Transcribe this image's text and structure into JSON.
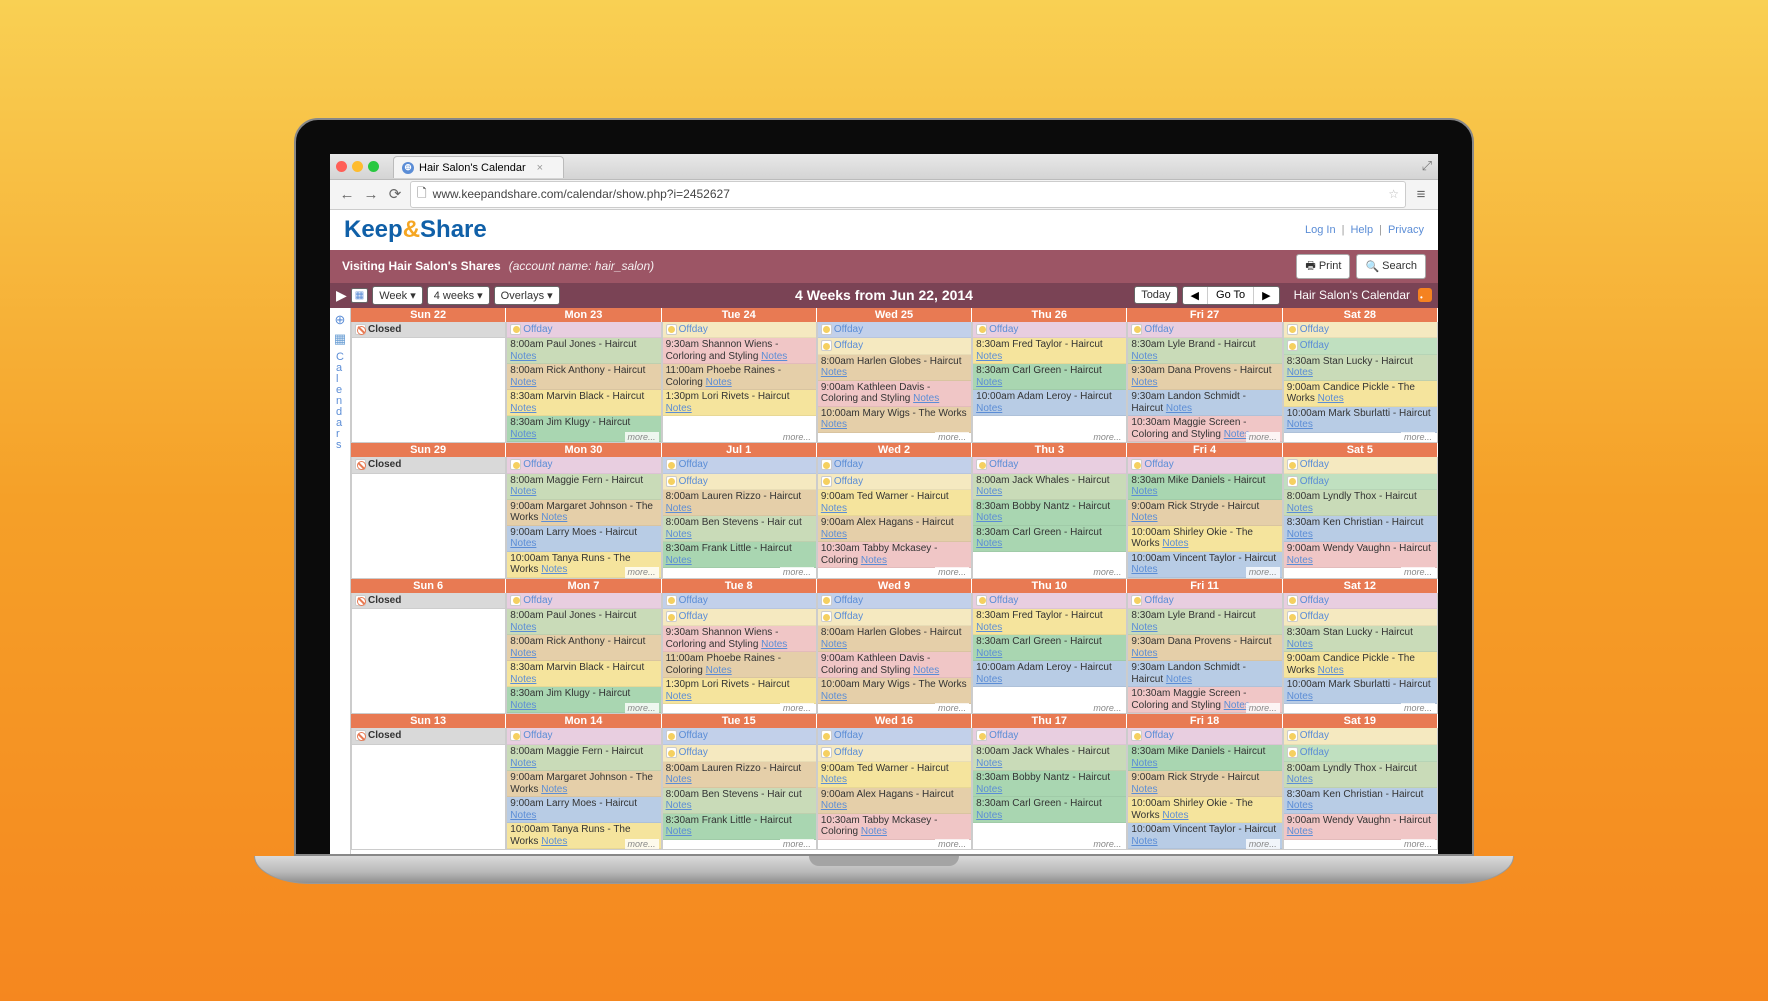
{
  "browser": {
    "tab_title": "Hair Salon's Calendar",
    "url": "www.keepandshare.com/calendar/show.php?i=2452627"
  },
  "header": {
    "login": "Log In",
    "help": "Help",
    "privacy": "Privacy"
  },
  "visit": {
    "text": "Visiting Hair Salon's Shares",
    "acct_label": "account name:",
    "acct": "hair_salon",
    "print": "Print",
    "search": "Search"
  },
  "toolbar": {
    "week": "Week ▾",
    "four": "4 weeks ▾",
    "overlays": "Overlays ▾",
    "title": "4 Weeks from Jun 22, 2014",
    "today": "Today",
    "goto": "Go To",
    "cal_name": "Hair Salon's Calendar"
  },
  "closed": "Closed",
  "offday": "Offday",
  "more": "more...",
  "notes": "Notes",
  "sidebar_word": "Calendars",
  "weeks": [
    {
      "headers": [
        "Sun 22",
        "Mon 23",
        "Tue 24",
        "Wed 25",
        "Thu 26",
        "Fri 27",
        "Sat 28"
      ],
      "days": [
        {
          "closed": true,
          "off": [],
          "events": []
        },
        {
          "off": [
            "p"
          ],
          "events": [
            {
              "t": "8:00am",
              "n": "Paul Jones",
              "s": "Haircut",
              "c": "kb"
            },
            {
              "t": "8:00am",
              "n": "Rick Anthony",
              "s": "Haircut",
              "c": "tt"
            },
            {
              "t": "8:30am",
              "n": "Marvin Black",
              "s": "Haircut",
              "c": "aj"
            },
            {
              "t": "8:30am",
              "n": "Jim Klugy",
              "s": "Haircut",
              "c": "jt"
            }
          ]
        },
        {
          "off": [
            "y"
          ],
          "events": [
            {
              "t": "9:30am",
              "n": "Shannon Wiens",
              "s": "Corloring and Styling",
              "c": "np"
            },
            {
              "t": "11:00am",
              "n": "Phoebe Raines",
              "s": "Coloring",
              "c": "cc"
            },
            {
              "t": "1:30pm",
              "n": "Lori Rivets",
              "s": "Haircut",
              "c": "aj"
            }
          ]
        },
        {
          "off": [
            "b",
            "y"
          ],
          "events": [
            {
              "t": "8:00am",
              "n": "Harlen Globes",
              "s": "Haircut",
              "c": "tt"
            },
            {
              "t": "9:00am",
              "n": "Kathleen Davis",
              "s": "Coloring and Styling",
              "c": "np"
            },
            {
              "t": "10:00am",
              "n": "Mary Wigs",
              "s": "The Works",
              "c": "cc"
            }
          ]
        },
        {
          "off": [
            "p"
          ],
          "events": [
            {
              "t": "8:30am",
              "n": "Fred Taylor",
              "s": "Haircut",
              "c": "aj"
            },
            {
              "t": "8:30am",
              "n": "Carl Green",
              "s": "Haircut",
              "c": "jt"
            },
            {
              "t": "10:00am",
              "n": "Adam Leroy",
              "s": "Haircut",
              "c": "ss"
            }
          ]
        },
        {
          "off": [
            "p"
          ],
          "events": [
            {
              "t": "8:30am",
              "n": "Lyle Brand",
              "s": "Haircut",
              "c": "kb"
            },
            {
              "t": "9:30am",
              "n": "Dana Provens",
              "s": "Haircut",
              "c": "cc"
            },
            {
              "t": "9:30am",
              "n": "Landon Schmidt",
              "s": "Haircut",
              "c": "ss"
            },
            {
              "t": "10:30am",
              "n": "Maggie Screen",
              "s": "Coloring and Styling",
              "c": "np"
            }
          ]
        },
        {
          "off": [
            "y",
            "g"
          ],
          "events": [
            {
              "t": "8:30am",
              "n": "Stan Lucky",
              "s": "Haircut",
              "c": "kb"
            },
            {
              "t": "9:00am",
              "n": "Candice Pickle",
              "s": "The Works",
              "c": "aj"
            },
            {
              "t": "10:00am",
              "n": "Mark Sburlatti",
              "s": "Haircut",
              "c": "ss"
            }
          ]
        }
      ]
    },
    {
      "headers": [
        "Sun 29",
        "Mon 30",
        "Jul 1",
        "Wed 2",
        "Thu 3",
        "Fri 4",
        "Sat 5"
      ],
      "days": [
        {
          "closed": true,
          "off": [],
          "events": []
        },
        {
          "off": [
            "p"
          ],
          "events": [
            {
              "t": "8:00am",
              "n": "Maggie Fern",
              "s": "Haircut",
              "c": "kb"
            },
            {
              "t": "9:00am",
              "n": "Margaret Johnson",
              "s": "The Works",
              "c": "tt"
            },
            {
              "t": "9:00am",
              "n": "Larry Moes",
              "s": "Haircut",
              "c": "ss"
            },
            {
              "t": "10:00am",
              "n": "Tanya Runs",
              "s": "The Works",
              "c": "aj"
            }
          ]
        },
        {
          "off": [
            "b",
            "y"
          ],
          "events": [
            {
              "t": "8:00am",
              "n": "Lauren Rizzo",
              "s": "Haircut",
              "c": "cc"
            },
            {
              "t": "8:00am",
              "n": "Ben Stevens",
              "s": "Hair cut",
              "c": "kb"
            },
            {
              "t": "8:30am",
              "n": "Frank Little",
              "s": "Haircut",
              "c": "jt"
            }
          ]
        },
        {
          "off": [
            "b",
            "y"
          ],
          "events": [
            {
              "t": "9:00am",
              "n": "Ted Warner",
              "s": "Haircut",
              "c": "aj"
            },
            {
              "t": "9:00am",
              "n": "Alex Hagans",
              "s": "Haircut",
              "c": "tt"
            },
            {
              "t": "10:30am",
              "n": "Tabby Mckasey",
              "s": "Coloring",
              "c": "np"
            }
          ]
        },
        {
          "off": [
            "p"
          ],
          "events": [
            {
              "t": "8:00am",
              "n": "Jack Whales",
              "s": "Haircut",
              "c": "kb"
            },
            {
              "t": "8:30am",
              "n": "Bobby Nantz",
              "s": "Haircut",
              "c": "jt"
            },
            {
              "t": "8:30am",
              "n": "Carl Green",
              "s": "Haircut",
              "c": "jt"
            }
          ]
        },
        {
          "off": [
            "p"
          ],
          "events": [
            {
              "t": "8:30am",
              "n": "Mike Daniels",
              "s": "Haircut",
              "c": "jt"
            },
            {
              "t": "9:00am",
              "n": "Rick Stryde",
              "s": "Haircut",
              "c": "tt"
            },
            {
              "t": "10:00am",
              "n": "Shirley Okie",
              "s": "The Works",
              "c": "aj"
            },
            {
              "t": "10:00am",
              "n": "Vincent Taylor",
              "s": "Haircut",
              "c": "ss"
            }
          ]
        },
        {
          "off": [
            "y",
            "g"
          ],
          "events": [
            {
              "t": "8:00am",
              "n": "Lyndly Thox",
              "s": "Haircut",
              "c": "kb"
            },
            {
              "t": "8:30am",
              "n": "Ken Christian",
              "s": "Haircut",
              "c": "ss"
            },
            {
              "t": "9:00am",
              "n": "Wendy Vaughn",
              "s": "Haircut",
              "c": "np"
            }
          ]
        }
      ]
    },
    {
      "headers": [
        "Sun 6",
        "Mon 7",
        "Tue 8",
        "Wed 9",
        "Thu 10",
        "Fri 11",
        "Sat 12"
      ],
      "days": [
        {
          "closed": true,
          "off": [],
          "events": []
        },
        {
          "off": [
            "p"
          ],
          "events": [
            {
              "t": "8:00am",
              "n": "Paul Jones",
              "s": "Haircut",
              "c": "kb"
            },
            {
              "t": "8:00am",
              "n": "Rick Anthony",
              "s": "Haircut",
              "c": "tt"
            },
            {
              "t": "8:30am",
              "n": "Marvin Black",
              "s": "Haircut",
              "c": "aj"
            },
            {
              "t": "8:30am",
              "n": "Jim Klugy",
              "s": "Haircut",
              "c": "jt"
            }
          ]
        },
        {
          "off": [
            "b",
            "y"
          ],
          "events": [
            {
              "t": "9:30am",
              "n": "Shannon Wiens",
              "s": "Corloring and Styling",
              "c": "np"
            },
            {
              "t": "11:00am",
              "n": "Phoebe Raines",
              "s": "Coloring",
              "c": "cc"
            },
            {
              "t": "1:30pm",
              "n": "Lori Rivets",
              "s": "Haircut",
              "c": "aj"
            }
          ]
        },
        {
          "off": [
            "b",
            "y"
          ],
          "events": [
            {
              "t": "8:00am",
              "n": "Harlen Globes",
              "s": "Haircut",
              "c": "tt"
            },
            {
              "t": "9:00am",
              "n": "Kathleen Davis",
              "s": "Coloring and Styling",
              "c": "np"
            },
            {
              "t": "10:00am",
              "n": "Mary Wigs",
              "s": "The Works",
              "c": "cc"
            }
          ]
        },
        {
          "off": [
            "p"
          ],
          "events": [
            {
              "t": "8:30am",
              "n": "Fred Taylor",
              "s": "Haircut",
              "c": "aj"
            },
            {
              "t": "8:30am",
              "n": "Carl Green",
              "s": "Haircut",
              "c": "jt"
            },
            {
              "t": "10:00am",
              "n": "Adam Leroy",
              "s": "Haircut",
              "c": "ss"
            }
          ]
        },
        {
          "off": [
            "p"
          ],
          "events": [
            {
              "t": "8:30am",
              "n": "Lyle Brand",
              "s": "Haircut",
              "c": "kb"
            },
            {
              "t": "9:30am",
              "n": "Dana Provens",
              "s": "Haircut",
              "c": "cc"
            },
            {
              "t": "9:30am",
              "n": "Landon Schmidt",
              "s": "Haircut",
              "c": "ss"
            },
            {
              "t": "10:30am",
              "n": "Maggie Screen",
              "s": "Coloring and Styling",
              "c": "np"
            }
          ]
        },
        {
          "off": [
            "p",
            "y"
          ],
          "events": [
            {
              "t": "8:30am",
              "n": "Stan Lucky",
              "s": "Haircut",
              "c": "kb"
            },
            {
              "t": "9:00am",
              "n": "Candice Pickle",
              "s": "The Works",
              "c": "aj"
            },
            {
              "t": "10:00am",
              "n": "Mark Sburlatti",
              "s": "Haircut",
              "c": "ss"
            }
          ]
        }
      ]
    },
    {
      "headers": [
        "Sun 13",
        "Mon 14",
        "Tue 15",
        "Wed 16",
        "Thu 17",
        "Fri 18",
        "Sat 19"
      ],
      "days": [
        {
          "closed": true,
          "off": [],
          "events": []
        },
        {
          "off": [
            "p"
          ],
          "events": [
            {
              "t": "8:00am",
              "n": "Maggie Fern",
              "s": "Haircut",
              "c": "kb"
            },
            {
              "t": "9:00am",
              "n": "Margaret Johnson",
              "s": "The Works",
              "c": "tt"
            },
            {
              "t": "9:00am",
              "n": "Larry Moes",
              "s": "Haircut",
              "c": "ss"
            },
            {
              "t": "10:00am",
              "n": "Tanya Runs",
              "s": "The Works",
              "c": "aj"
            }
          ]
        },
        {
          "off": [
            "b",
            "y"
          ],
          "events": [
            {
              "t": "8:00am",
              "n": "Lauren Rizzo",
              "s": "Haircut",
              "c": "cc"
            },
            {
              "t": "8:00am",
              "n": "Ben Stevens",
              "s": "Hair cut",
              "c": "kb"
            },
            {
              "t": "8:30am",
              "n": "Frank Little",
              "s": "Haircut",
              "c": "jt"
            }
          ]
        },
        {
          "off": [
            "b",
            "y"
          ],
          "events": [
            {
              "t": "9:00am",
              "n": "Ted Warner",
              "s": "Haircut",
              "c": "aj"
            },
            {
              "t": "9:00am",
              "n": "Alex Hagans",
              "s": "Haircut",
              "c": "tt"
            },
            {
              "t": "10:30am",
              "n": "Tabby Mckasey",
              "s": "Coloring",
              "c": "np"
            }
          ]
        },
        {
          "off": [
            "p"
          ],
          "events": [
            {
              "t": "8:00am",
              "n": "Jack Whales",
              "s": "Haircut",
              "c": "kb"
            },
            {
              "t": "8:30am",
              "n": "Bobby Nantz",
              "s": "Haircut",
              "c": "jt"
            },
            {
              "t": "8:30am",
              "n": "Carl Green",
              "s": "Haircut",
              "c": "jt"
            }
          ]
        },
        {
          "off": [
            "p"
          ],
          "events": [
            {
              "t": "8:30am",
              "n": "Mike Daniels",
              "s": "Haircut",
              "c": "jt"
            },
            {
              "t": "9:00am",
              "n": "Rick Stryde",
              "s": "Haircut",
              "c": "tt"
            },
            {
              "t": "10:00am",
              "n": "Shirley Okie",
              "s": "The Works",
              "c": "aj"
            },
            {
              "t": "10:00am",
              "n": "Vincent Taylor",
              "s": "Haircut",
              "c": "ss"
            }
          ]
        },
        {
          "off": [
            "y",
            "g"
          ],
          "events": [
            {
              "t": "8:00am",
              "n": "Lyndly Thox",
              "s": "Haircut",
              "c": "kb"
            },
            {
              "t": "8:30am",
              "n": "Ken Christian",
              "s": "Haircut",
              "c": "ss"
            },
            {
              "t": "9:00am",
              "n": "Wendy Vaughn",
              "s": "Haircut",
              "c": "np"
            }
          ]
        }
      ]
    }
  ]
}
